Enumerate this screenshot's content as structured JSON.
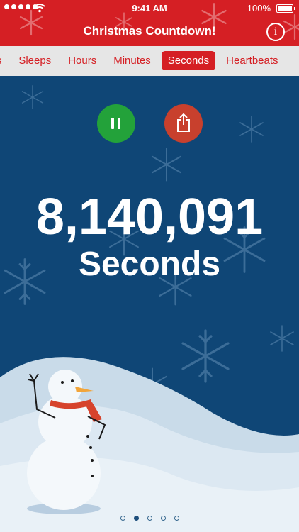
{
  "status_bar": {
    "time": "9:41 AM",
    "battery": "100%"
  },
  "header": {
    "title": "Christmas Countdown!",
    "info_icon": "i"
  },
  "tabs": [
    {
      "label": "eks",
      "active": false
    },
    {
      "label": "Sleeps",
      "active": false
    },
    {
      "label": "Hours",
      "active": false
    },
    {
      "label": "Minutes",
      "active": false
    },
    {
      "label": "Seconds",
      "active": true
    },
    {
      "label": "Heartbeats",
      "active": false
    }
  ],
  "controls": {
    "pause_icon": "pause-icon",
    "share_icon": "share-icon"
  },
  "countdown": {
    "number": "8,140,091",
    "unit": "Seconds"
  },
  "pager": {
    "count": 5,
    "active_index": 1
  },
  "colors": {
    "header_red": "#d51f24",
    "background_blue": "#0f4676",
    "pause_green": "#23a23a",
    "share_red": "#c8402d"
  }
}
